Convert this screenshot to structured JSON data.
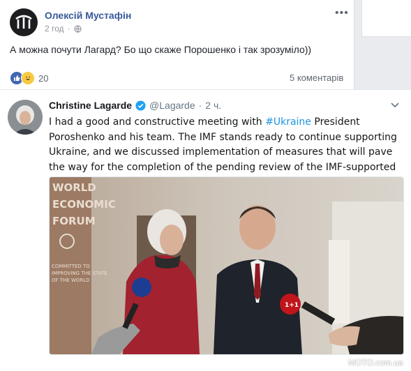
{
  "fb_post": {
    "author": "Олексій Мустафін",
    "time": "2 год",
    "text": "А можна почути Лагард? Бо що скаже Порошенко і так зрозуміло))",
    "reaction_count": "20",
    "comments": "5 коментарів",
    "more_icon": "ellipsis-icon",
    "privacy_icon": "globe-icon"
  },
  "tweet": {
    "name": "Christine Lagarde",
    "handle": "@Lagarde",
    "separator": "·",
    "time": "2 ч.",
    "text_before": "I had a good and constructive meeting with ",
    "hashtag": "#Ukraine",
    "text_after": " President Poroshenko and his team. The IMF stands ready to continue supporting Ukraine, and we discussed implementation of measures that will pave the way for the completion of the pending review of the IMF-supported program.",
    "photo_sign": [
      "WORLD",
      "ECONOMIC",
      "FORUM"
    ],
    "photo_tagline": [
      "COMMITTED TO",
      "IMPROVING THE STATE",
      "OF THE WORLD"
    ],
    "mic_label": "1+1"
  },
  "watermark": "MOTO.com.ua",
  "colors": {
    "fb_link": "#365899",
    "hashtag": "#1b95e0",
    "verified": "#1da1f2"
  }
}
